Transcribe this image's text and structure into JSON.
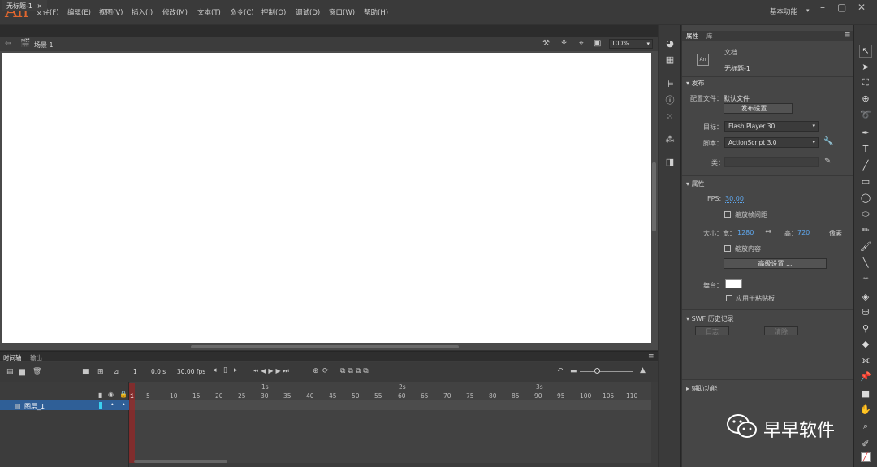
{
  "app": {
    "logo": "An"
  },
  "menu": [
    "文件(F)",
    "编辑(E)",
    "视图(V)",
    "插入(I)",
    "修改(M)",
    "文本(T)",
    "命令(C)",
    "控制(O)",
    "调试(D)",
    "窗口(W)",
    "帮助(H)"
  ],
  "workspace": {
    "label": "基本功能"
  },
  "document": {
    "tab_title": "无标题-1",
    "scene": "场景 1",
    "zoom": "100%"
  },
  "properties": {
    "tabs": [
      "属性",
      "库"
    ],
    "doc_type": "文档",
    "doc_name": "无标题-1",
    "publish": {
      "header": "发布",
      "profile_label": "配置文件：",
      "profile_value": "默认文件",
      "settings_button": "发布设置 ...",
      "target_label": "目标：",
      "target_value": "Flash Player 30",
      "script_label": "脚本：",
      "script_value": "ActionScript 3.0",
      "class_label": "类："
    },
    "attributes": {
      "header": "属性",
      "fps_label": "FPS:",
      "fps_value": "30.00",
      "scale_frame_label": "缩放帧间距",
      "size_label": "大小：",
      "width_label": "宽：",
      "width_value": "1280",
      "height_label": "高：",
      "height_value": "720",
      "unit": "像素",
      "scale_content_label": "缩放内容",
      "advanced_button": "高级设置 ...",
      "stage_label": "舞台：",
      "paste_board_label": "应用于粘贴板"
    },
    "swf_history": {
      "header": "SWF 历史记录",
      "log_button": "日志",
      "clear_button": "清除"
    },
    "accessibility": {
      "header": "辅助功能"
    }
  },
  "timeline": {
    "tabs": [
      "时间轴",
      "输出"
    ],
    "frame": "1",
    "time": "0.0 s",
    "fps": "30.00 fps",
    "layer_name": "图层_1",
    "seconds": [
      "1s",
      "2s",
      "3s"
    ],
    "ticks": [
      "1",
      "5",
      "10",
      "15",
      "20",
      "25",
      "30",
      "35",
      "40",
      "45",
      "50",
      "55",
      "60",
      "65",
      "70",
      "75",
      "80",
      "85",
      "90",
      "95",
      "100",
      "105",
      "110"
    ]
  },
  "watermark": {
    "text": "早早软件"
  },
  "colors": {
    "accent": "#e0672f",
    "layer_selected": "#2f5f97",
    "playhead": "#e03a3a"
  }
}
